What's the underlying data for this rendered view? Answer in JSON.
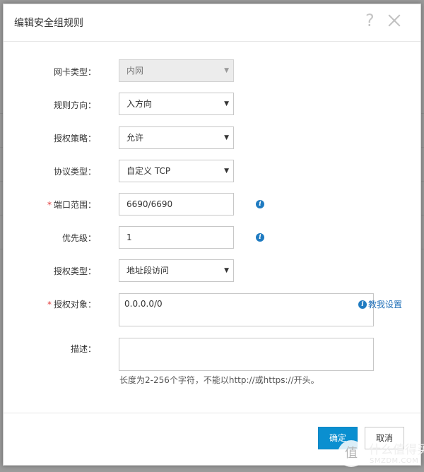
{
  "dialog": {
    "title": "编辑安全组规则",
    "help_glyph": "?"
  },
  "form": {
    "nic_type": {
      "label": "网卡类型：",
      "value": "内网"
    },
    "direction": {
      "label": "规则方向：",
      "value": "入方向"
    },
    "policy": {
      "label": "授权策略：",
      "value": "允许"
    },
    "protocol": {
      "label": "协议类型：",
      "value": "自定义 TCP"
    },
    "port_range": {
      "label": "端口范围：",
      "value": "6690/6690",
      "required_mark": "*"
    },
    "priority": {
      "label": "优先级：",
      "value": "1"
    },
    "auth_type": {
      "label": "授权类型：",
      "value": "地址段访问"
    },
    "auth_object": {
      "label": "授权对象：",
      "value": "0.0.0.0/0",
      "required_mark": "*",
      "help_link": "教我设置"
    },
    "description": {
      "label": "描述：",
      "value": "",
      "hint": "长度为2-256个字符，不能以http://或https://开头。"
    }
  },
  "buttons": {
    "ok": "确定",
    "cancel": "取消"
  },
  "watermark": {
    "badge": "值",
    "text": "什么值得买",
    "sub": "SMZDM.COM"
  },
  "colors": {
    "primary": "#0a8fd0",
    "required": "#e23c3c",
    "info": "#1f7bc1",
    "link": "#1f6fb8"
  },
  "icons": [
    "help-icon",
    "close-icon",
    "caret-down-icon",
    "info-icon"
  ]
}
